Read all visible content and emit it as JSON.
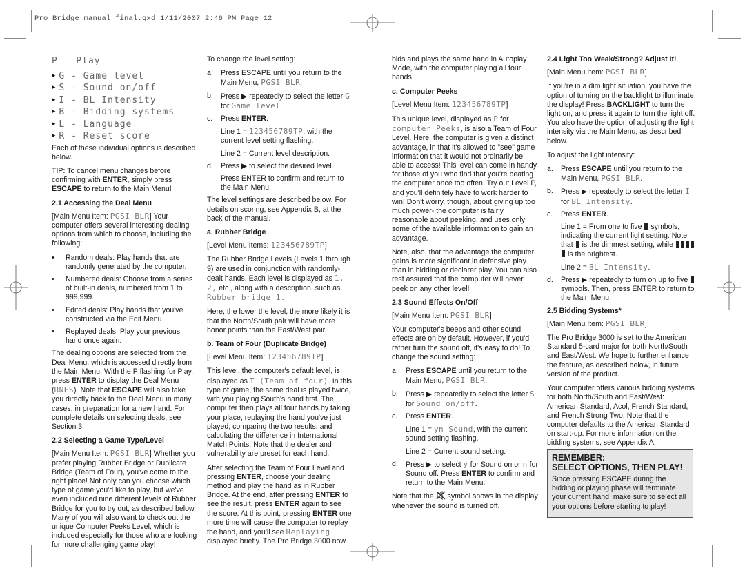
{
  "slug": "Pro Bridge manual final.qxd  1/11/2007  2:46 PM  Page 12",
  "col1": {
    "menu_title": "P - Play",
    "menu_items": [
      "G - Game level",
      "S - Sound on/off",
      "I - BL Intensity",
      "B - Bidding systems",
      "L - Language",
      "R - Reset score"
    ],
    "intro": "Each of these individual options is described below.",
    "tip_a": "TIP: To cancel menu changes before confirming with ",
    "tip_enter": "ENTER",
    "tip_b": ", simply press ",
    "tip_escape": "ESCAPE",
    "tip_c": " to return to the Main Menu!",
    "s21_title": "2.1 Accessing the Deal Menu",
    "s21_pre": "[Main Menu Item: ",
    "s21_lcd": "PGSI BLR",
    "s21_post": "] Your computer offers several interesting dealing options from which to choose, including the following:",
    "bullets": [
      "Random deals: Play hands that are randomly generated by the computer.",
      "Numbered deals: Choose from a series of built-in deals, numbered from 1 to 999,999.",
      "Edited deals: Play hands that you've constructed via the Edit Menu.",
      "Replayed deals: Play your previous hand once again."
    ],
    "deal_a": "The dealing options are selected from the Deal Menu, which is accessed directly from the Main Menu. With the P flashing for Play, press ",
    "deal_enter": "ENTER",
    "deal_b": " to display the Deal Menu (",
    "deal_lcd": "RNES",
    "deal_c": "). Note that ",
    "deal_escape": "ESCAPE",
    "deal_d": " will also take you directly back to the Deal Menu in many cases, in preparation for a new hand. For complete details on selecting deals, see Section 3.",
    "s22_title": "2.2 Selecting a Game Type/Level",
    "s22_pre": "[Main Menu Item: ",
    "s22_lcd": "PGSI BLR",
    "s22_post": "] Whether you prefer playing Rubber Bridge or Duplicate Bridge (Team of Four), you've come to the right place! Not only can you choose which type of game you'd like to play, but we've even included nine different levels of Rubber Bridge for you to try out, as described below. Many of you will also want to check out the unique Computer Peeks Level, which is included especially for those who are looking for more challenging game play!"
  },
  "col2": {
    "intro": "To change the level setting:",
    "a_label": "a.",
    "a_text": "Press ESCAPE until you return to the Main Menu, ",
    "a_lcd": "PGSI BLR",
    "b_label": "b.",
    "b_text": "Press ▶ repeatedly to select the letter ",
    "b_lcd1": "G",
    "b_for": "for ",
    "b_lcd2": "Game level",
    "c_label": "c.",
    "c_text": "Press ",
    "c_enter": "ENTER",
    "line1_pre": "Line 1 = ",
    "line1_lcd": "123456789TP",
    "line1_post": ", with the current level setting flashing.",
    "line2": "Line 2 = Current level description.",
    "d_label": "d.",
    "d_text": "Press ▶ to select the desired level.",
    "d_confirm": "Press ENTER to confirm and return to the Main Menu.",
    "levels_note": "The level settings are described below. For details on scoring, see Appendix B, at the back of the manual.",
    "ra_title": "a. Rubber Bridge",
    "ra_item_pre": "[Level Menu Items: ",
    "ra_item_lcd": "123456789TP",
    "ra_item_post": "]",
    "ra_p1a": "The Rubber Bridge Levels (Levels 1 through 9) are used in conjunction with randomly-dealt hands. Each level is displayed as ",
    "ra_p1_lcd": "1, 2,",
    "ra_p1b": " etc., along with a description, such as ",
    "ra_p1_lcd2": "Rubber bridge 1.",
    "ra_p2": "Here, the lower the level, the more likely it is that the North/South pair will have more honor points than the East/West pair.",
    "tb_title": "b. Team of Four (Duplicate Bridge)",
    "tb_item_pre": "[Level Menu Item: ",
    "tb_item_lcd": "123456789TP",
    "tb_item_post": "]",
    "tb_p1a": "This level, the computer's default level, is displayed as ",
    "tb_p1_lcd": "T (Team of four)",
    "tb_p1b": ". In this type of game, the same deal is played twice, with you playing South's hand first. The computer then plays all four hands by taking your place, replaying the hand you've just played, comparing the two results, and calculating the difference in International Match Points. Note that the dealer and vulnerability are preset for each hand.",
    "tb_p2a": "After selecting the Team of Four Level and pressing ",
    "tb_p2_enter1": "ENTER",
    "tb_p2b": ", choose your dealing method and play the hand as in Rubber Bridge. At the end, after pressing ",
    "tb_p2_enter2": "ENTER",
    "tb_p2c": " to see the result, press ",
    "tb_p2_enter3": "ENTER",
    "tb_p2d": " again to see the score. At this point, pressing ",
    "tb_p2_enter4": "ENTER",
    "tb_p2e": " one more time will cause the computer to replay the hand, and you'll see ",
    "tb_p2_lcd": "Replaying",
    "tb_p2f": " displayed briefly. The Pro Bridge 3000 now"
  },
  "col3": {
    "cont": "bids and plays the same hand in Autoplay Mode, with the computer playing all four hands.",
    "cp_title": "c. Computer Peeks",
    "cp_item_pre": "[Level Menu Item: ",
    "cp_item_lcd": "123456789TP",
    "cp_item_post": "]",
    "cp_p1a": "This unique level, displayed as ",
    "cp_p1_lcd": "P",
    "cp_p1b": " for ",
    "cp_p1_lcd2": "computer Peeks",
    "cp_p1c": ", is also a Team of Four Level. Here, the computer is given a distinct advantage, in that it's allowed to \"see\" game information that it would not ordinarily be able to access! This level can come in handy for those of you who find that you're beating the computer once too often. Try out Level P, and you'll definitely have to work harder to win! Don't worry, though, about giving up too much power- the computer is fairly reasonable about peeking, and uses only some of the available information to gain an advantage.",
    "cp_p2": "Note, also, that the advantage the computer gains is more significant in defensive play than in bidding or declarer play. You can also rest assured that the computer will never peek on any other level!",
    "s23_title": "2.3 Sound Effects On/Off",
    "s23_pre": "[Main Menu Item: ",
    "s23_lcd": "PGSI BLR",
    "s23_post": "]",
    "s23_p1": "Your computer's beeps and other sound effects are on by default. However, if you'd rather turn the sound off, it's easy to do! To change the sound setting:",
    "a_label": "a.",
    "a_text1": "Press ",
    "a_escape": "ESCAPE",
    "a_text2": " until you return to the Main Menu, ",
    "a_lcd": "PGSI BLR",
    "b_label": "b.",
    "b_text": "Press ▶ repeatedly to select the letter ",
    "b_lcd1": "S",
    "b_for": "for ",
    "b_lcd2": "Sound on/off",
    "c_label": "c.",
    "c_text": "Press ",
    "c_enter": "ENTER",
    "line1_pre": "Line 1 = ",
    "line1_lcd": "yn Sound",
    "line1_post": ", with the current sound setting flashing.",
    "line2": "Line 2 = Current sound setting.",
    "d_label": "d.",
    "d_text1": "Press ▶ to select ",
    "d_lcd_y": "y",
    "d_text2": " for Sound on or ",
    "d_lcd_n": "n",
    "d_text3": " for Sound off. Press ",
    "d_enter": "ENTER",
    "d_text4": " to confirm and return to the Main Menu.",
    "note_a": "Note that the ",
    "note_b": " symbol shows in the display whenever the sound is turned off."
  },
  "col4": {
    "s24_title": "2.4 Light Too Weak/Strong? Adjust It!",
    "s24_pre": "[Main Menu Item: ",
    "s24_lcd": "PGSI BLR",
    "s24_post": "]",
    "s24_p1a": "If you're in a dim light situation, you have the option of turning on the backlight to illuminate the display! Press ",
    "s24_backlight": "BACKLIGHT",
    "s24_p1b": " to turn the light on, and press it again to turn the light off. You also have the option of adjusting the light intensity via the Main Menu, as described below.",
    "s24_p2": "To adjust the light intensity:",
    "a_label": "a.",
    "a_text1": "Press ",
    "a_escape": "ESCAPE",
    "a_text2": " until you return to the Main Menu, ",
    "a_lcd": "PGSI BLR",
    "b_label": "b.",
    "b_text": "Press ▶ repeatedly to select the letter ",
    "b_lcd1": "I",
    "b_for": "for ",
    "b_lcd2": "BL Intensity",
    "c_label": "c.",
    "c_text": "Press ",
    "c_enter": "ENTER",
    "line1_a": "Line 1 = From one to five ",
    "line1_b": " symbols, indicating the current light setting. Note that ",
    "line1_c": " is the dimmest setting, while ",
    "line1_d": " is the brightest.",
    "line2_pre": "Line 2 = ",
    "line2_lcd": "BL Intensity",
    "d_label": "d.",
    "d_text1": "Press ▶ repeatedly to turn on up to five ",
    "d_text2": " symbols. Then, press ENTER to return to the Main Menu.",
    "s25_title": "2.5 Bidding Systems*",
    "s25_pre": "[Main Menu Item: ",
    "s25_lcd": "PGSI BLR",
    "s25_post": "]",
    "s25_p1": "The Pro Bridge 3000 is set to the American Standard 5-card major for both North/South and East/West. We hope to further enhance the feature, as described below, in future version of the product.",
    "s25_p2": "Your computer offers various bidding systems for both North/South and East/West: American Standard, Acol, French Standard, and French Strong Two. Note that the computer defaults to the American Standard on start-up. For more information on the bidding systems, see Appendix A."
  },
  "remember": {
    "title1": "REMEMBER:",
    "title2": "SELECT OPTIONS, THEN PLAY!",
    "body": "Since pressing ESCAPE during the bidding or playing phase will terminate your current hand, make sure to select all your options before starting to play!"
  }
}
